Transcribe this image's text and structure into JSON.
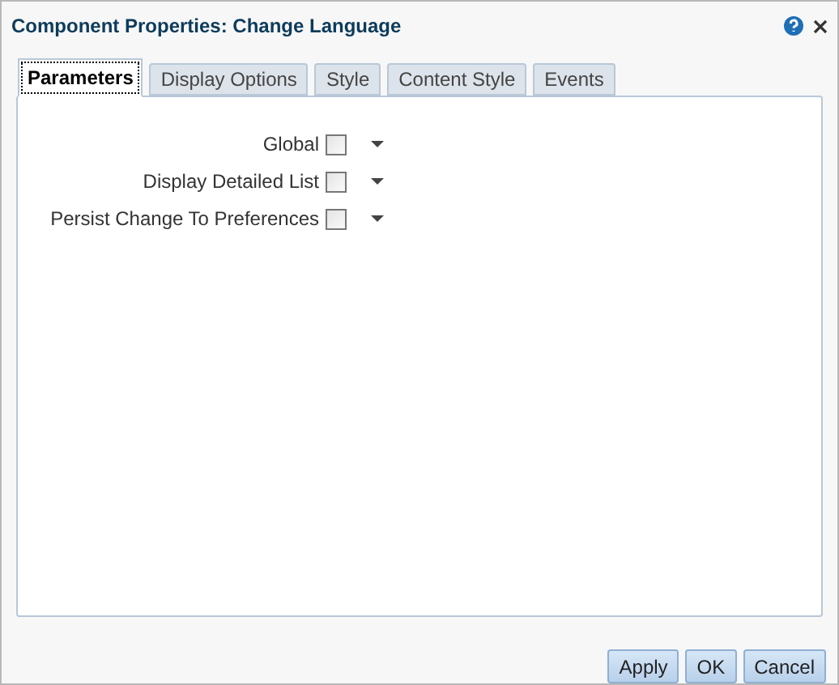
{
  "window": {
    "title": "Component Properties: Change Language"
  },
  "tabs": [
    {
      "label": "Parameters",
      "selected": true
    },
    {
      "label": "Display Options",
      "selected": false
    },
    {
      "label": "Style",
      "selected": false
    },
    {
      "label": "Content Style",
      "selected": false
    },
    {
      "label": "Events",
      "selected": false
    }
  ],
  "parameters": [
    {
      "label": "Global",
      "checked": false
    },
    {
      "label": "Display Detailed List",
      "checked": false
    },
    {
      "label": "Persist Change To Preferences",
      "checked": false
    }
  ],
  "buttons": [
    "Apply",
    "OK",
    "Cancel"
  ]
}
